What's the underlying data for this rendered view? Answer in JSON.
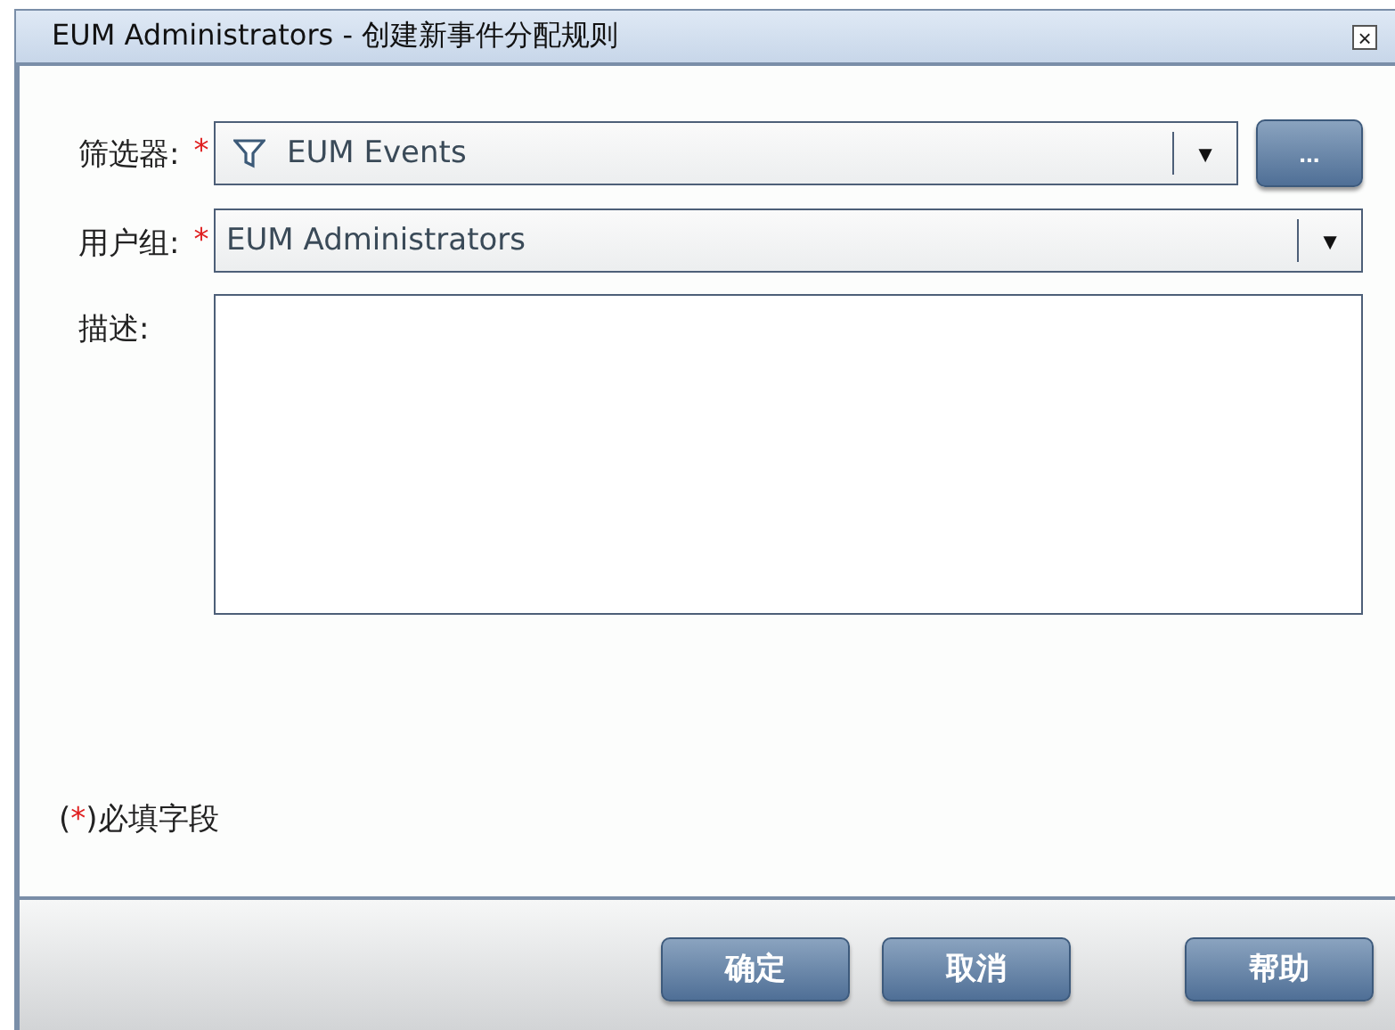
{
  "window": {
    "title": "EUM Administrators - 创建新事件分配规则",
    "close": "×"
  },
  "fields": [
    {
      "kind": "select",
      "label": "筛选器:",
      "required": true,
      "filter_icon": true,
      "value": "EUM Events",
      "dropdown": "▼",
      "extra_button": "..."
    },
    {
      "kind": "select",
      "label": "用户组:",
      "required": true,
      "filter_icon": false,
      "value": "EUM Administrators",
      "dropdown": "▼"
    },
    {
      "kind": "textarea",
      "label": "描述:",
      "required": false
    }
  ],
  "required_mark": "*",
  "legend": {
    "open": "(",
    "mark": "*",
    "text": ")必填字段"
  },
  "buttons": [
    "确定",
    "取消",
    "帮助"
  ]
}
